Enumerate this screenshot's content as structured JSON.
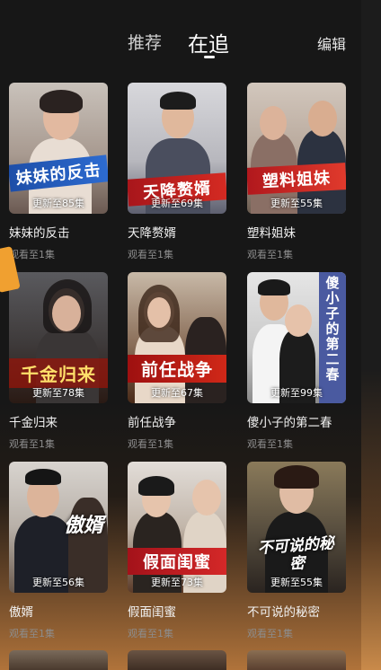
{
  "header": {
    "tabs": [
      {
        "label": "推荐",
        "active": false
      },
      {
        "label": "在追",
        "active": true
      }
    ],
    "edit_label": "编辑"
  },
  "dramas": [
    {
      "title": "妹妹的反击",
      "poster_text": "妹妹的反击",
      "progress": "更新至85集",
      "watched": "观看至1集"
    },
    {
      "title": "天降赘婿",
      "poster_text": "天降赘婿",
      "progress": "更新至69集",
      "watched": "观看至1集"
    },
    {
      "title": "塑料姐妹",
      "poster_text": "塑料姐妹",
      "progress": "更新至55集",
      "watched": "观看至1集"
    },
    {
      "title": "千金归来",
      "poster_text": "千金归来",
      "progress": "更新至78集",
      "watched": "观看至1集"
    },
    {
      "title": "前任战争",
      "poster_text": "前任战争",
      "progress": "更新至67集",
      "watched": "观看至1集"
    },
    {
      "title": "傻小子的第二春",
      "poster_text": "傻小子的第二春",
      "progress": "更新至99集",
      "watched": "观看至1集"
    },
    {
      "title": "傲婿",
      "poster_text": "傲婿",
      "progress": "更新至56集",
      "watched": "观看至1集"
    },
    {
      "title": "假面闺蜜",
      "poster_text": "假面闺蜜",
      "progress": "更新至73集",
      "watched": "观看至1集"
    },
    {
      "title": "不可说的秘密",
      "poster_text": "不可说的秘密",
      "progress": "更新至55集",
      "watched": "观看至1集"
    }
  ],
  "colors": {
    "background": "#171717",
    "accent": "#c4312b",
    "muted_text": "#8d8d8d"
  }
}
